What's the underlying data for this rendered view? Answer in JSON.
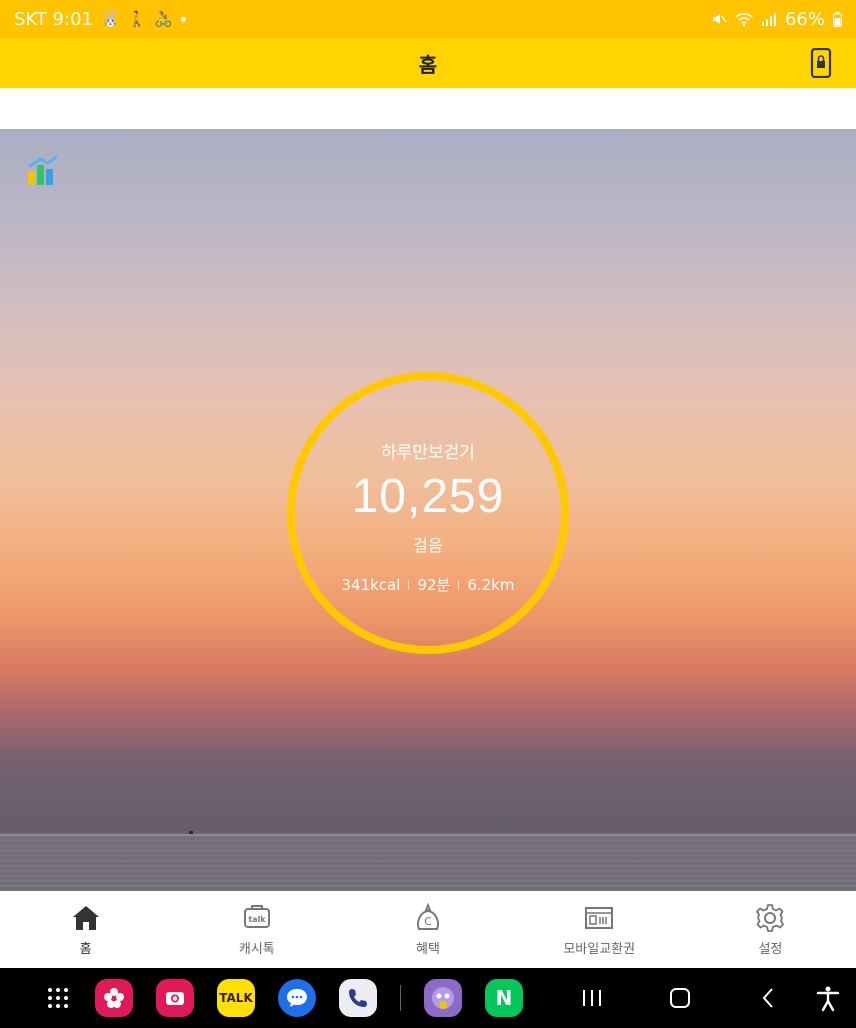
{
  "status_bar": {
    "carrier_time": "SKT 9:01",
    "battery": "66%"
  },
  "app_bar": {
    "title": "홈"
  },
  "hero": {
    "ring_title": "하루만보걷기",
    "steps": "10,259",
    "steps_unit": "걸음",
    "calories": "341kcal",
    "duration": "92분",
    "distance": "6.2km",
    "ring_color": "#FFC800"
  },
  "bottom_nav": {
    "items": [
      {
        "label": "홈",
        "icon": "home-icon",
        "active": true
      },
      {
        "label": "캐시톡",
        "icon": "talk-bubble-icon",
        "active": false
      },
      {
        "label": "혜택",
        "icon": "coin-icon",
        "active": false
      },
      {
        "label": "모바일교환권",
        "icon": "ticket-icon",
        "active": false
      },
      {
        "label": "설정",
        "icon": "gear-icon",
        "active": false
      }
    ]
  },
  "dock": {
    "apps": [
      {
        "name": "blossom-app-icon",
        "color": "#E0195A"
      },
      {
        "name": "camera-app-icon",
        "color": "#E0195A"
      },
      {
        "name": "kakaotalk-icon",
        "color": "#FFE000",
        "label": "TALK"
      },
      {
        "name": "messages-icon",
        "color": "#1E6FE8"
      },
      {
        "name": "phone-app-icon",
        "color": "#EDEDF5"
      },
      {
        "name": "game-character-icon",
        "color": "#8C6BC8"
      },
      {
        "name": "naver-icon",
        "color": "#03C75A",
        "label": "N"
      }
    ]
  },
  "colors": {
    "status_bar": "#FFC300",
    "app_bar": "#FFD400"
  }
}
